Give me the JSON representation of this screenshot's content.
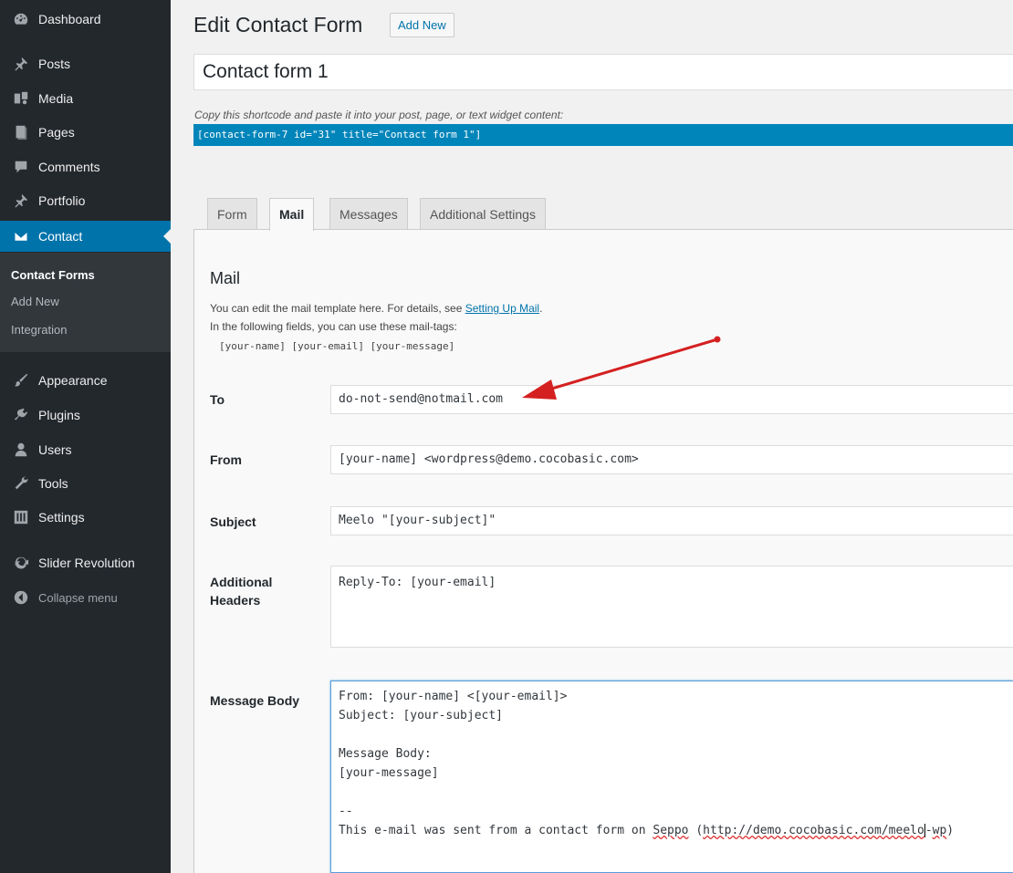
{
  "sidebar": {
    "items": [
      {
        "label": "Dashboard",
        "icon": "dashboard-icon"
      },
      {
        "label": "Posts",
        "icon": "pin-icon"
      },
      {
        "label": "Media",
        "icon": "media-icon"
      },
      {
        "label": "Pages",
        "icon": "pages-icon"
      },
      {
        "label": "Comments",
        "icon": "comments-icon"
      },
      {
        "label": "Portfolio",
        "icon": "pin-icon"
      },
      {
        "label": "Contact",
        "icon": "envelope-icon"
      }
    ],
    "submenu": [
      {
        "label": "Contact Forms"
      },
      {
        "label": "Add New"
      },
      {
        "label": "Integration"
      }
    ],
    "items2": [
      {
        "label": "Appearance",
        "icon": "brush-icon"
      },
      {
        "label": "Plugins",
        "icon": "plugin-icon"
      },
      {
        "label": "Users",
        "icon": "users-icon"
      },
      {
        "label": "Tools",
        "icon": "wrench-icon"
      },
      {
        "label": "Settings",
        "icon": "settings-icon"
      },
      {
        "label": "Slider Revolution",
        "icon": "refresh-icon"
      }
    ],
    "collapse_label": "Collapse menu"
  },
  "header": {
    "title": "Edit Contact Form",
    "add_new_label": "Add New"
  },
  "form": {
    "title_value": "Contact form 1",
    "shortcode_note": "Copy this shortcode and paste it into your post, page, or text widget content:",
    "shortcode": "[contact-form-7 id=\"31\" title=\"Contact form 1\"]"
  },
  "tabs": [
    {
      "label": "Form"
    },
    {
      "label": "Mail"
    },
    {
      "label": "Messages"
    },
    {
      "label": "Additional Settings"
    }
  ],
  "mail": {
    "heading": "Mail",
    "desc1_prefix": "You can edit the mail template here. For details, see ",
    "desc1_link": "Setting Up Mail",
    "desc1_suffix": ".",
    "desc2": "In the following fields, you can use these mail-tags:",
    "mail_tags": "[your-name] [your-email] [your-message]",
    "fields": {
      "to_label": "To",
      "to_value": "do-not-send@notmail.com",
      "from_label": "From",
      "from_value": "[your-name] <wordpress@demo.cocobasic.com>",
      "subject_label": "Subject",
      "subject_value": "Meelo \"[your-subject]\"",
      "headers_label_line1": "Additional",
      "headers_label_line2": "Headers",
      "headers_value": "Reply-To: [your-email]",
      "body_label": "Message Body",
      "body_line1": "From: [your-name] <[your-email]>",
      "body_line2": "Subject: [your-subject]",
      "body_line3": "Message Body:",
      "body_line4": "[your-message]",
      "body_line5": "--",
      "body_line6_a": "This e-mail was sent from a contact form on ",
      "body_line6_b": "Seppo",
      "body_line6_c": " (",
      "body_line6_d": "http://demo.cocobasic.com/meelo",
      "body_line6_e": "-",
      "body_line6_f": "wp",
      "body_line6_g": ")"
    }
  },
  "colors": {
    "sidebar_bg": "#23282d",
    "accent": "#0073aa",
    "shortcode_bg": "#0085ba",
    "arrow": "#d42020"
  }
}
